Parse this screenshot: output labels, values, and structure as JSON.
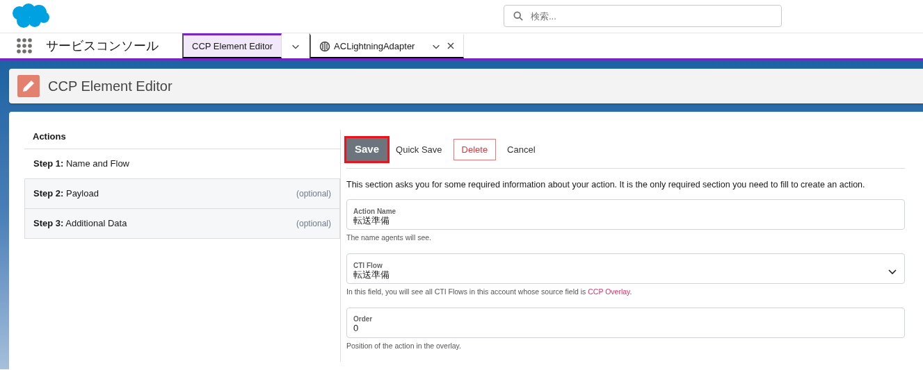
{
  "header": {
    "search": {
      "placeholder": "検索..."
    }
  },
  "nav": {
    "app_name": "サービスコンソール",
    "tabs": [
      {
        "label": "CCP Element Editor",
        "selected": true,
        "closable": false
      },
      {
        "label": "ACLightningAdapter",
        "selected": false,
        "closable": true
      }
    ]
  },
  "page_header": {
    "title": "CCP Element Editor"
  },
  "actions": {
    "title": "Actions",
    "steps": [
      {
        "step": "Step 1:",
        "name": "Name and Flow",
        "selected": true
      },
      {
        "step": "Step 2:",
        "name": "Payload",
        "optional": "(optional)",
        "selected": false
      },
      {
        "step": "Step 3:",
        "name": "Additional Data",
        "optional": "(optional)",
        "selected": false
      }
    ]
  },
  "toolbar": [
    {
      "label": "Save",
      "kind": "primary",
      "highlighted": true
    },
    {
      "label": "Quick Save",
      "kind": "plain"
    },
    {
      "label": "Delete",
      "kind": "danger"
    },
    {
      "label": "Cancel",
      "kind": "plain"
    }
  ],
  "intro": "This section asks you for some required information about your action. It is the only required section you need to fill to create an action.",
  "fields": [
    {
      "kind": "text",
      "label": "Action Name",
      "value": "転送準備",
      "help": "The name agents will see."
    },
    {
      "kind": "select",
      "label": "CTI Flow",
      "value": "転送準備",
      "help": "In this field, you will see all CTI Flows in this account whose source field is ",
      "help_link": "CCP Overlay",
      "help_after": "."
    },
    {
      "kind": "text",
      "label": "Order",
      "value": "0",
      "help": "Position of the action in the overlay."
    }
  ]
}
